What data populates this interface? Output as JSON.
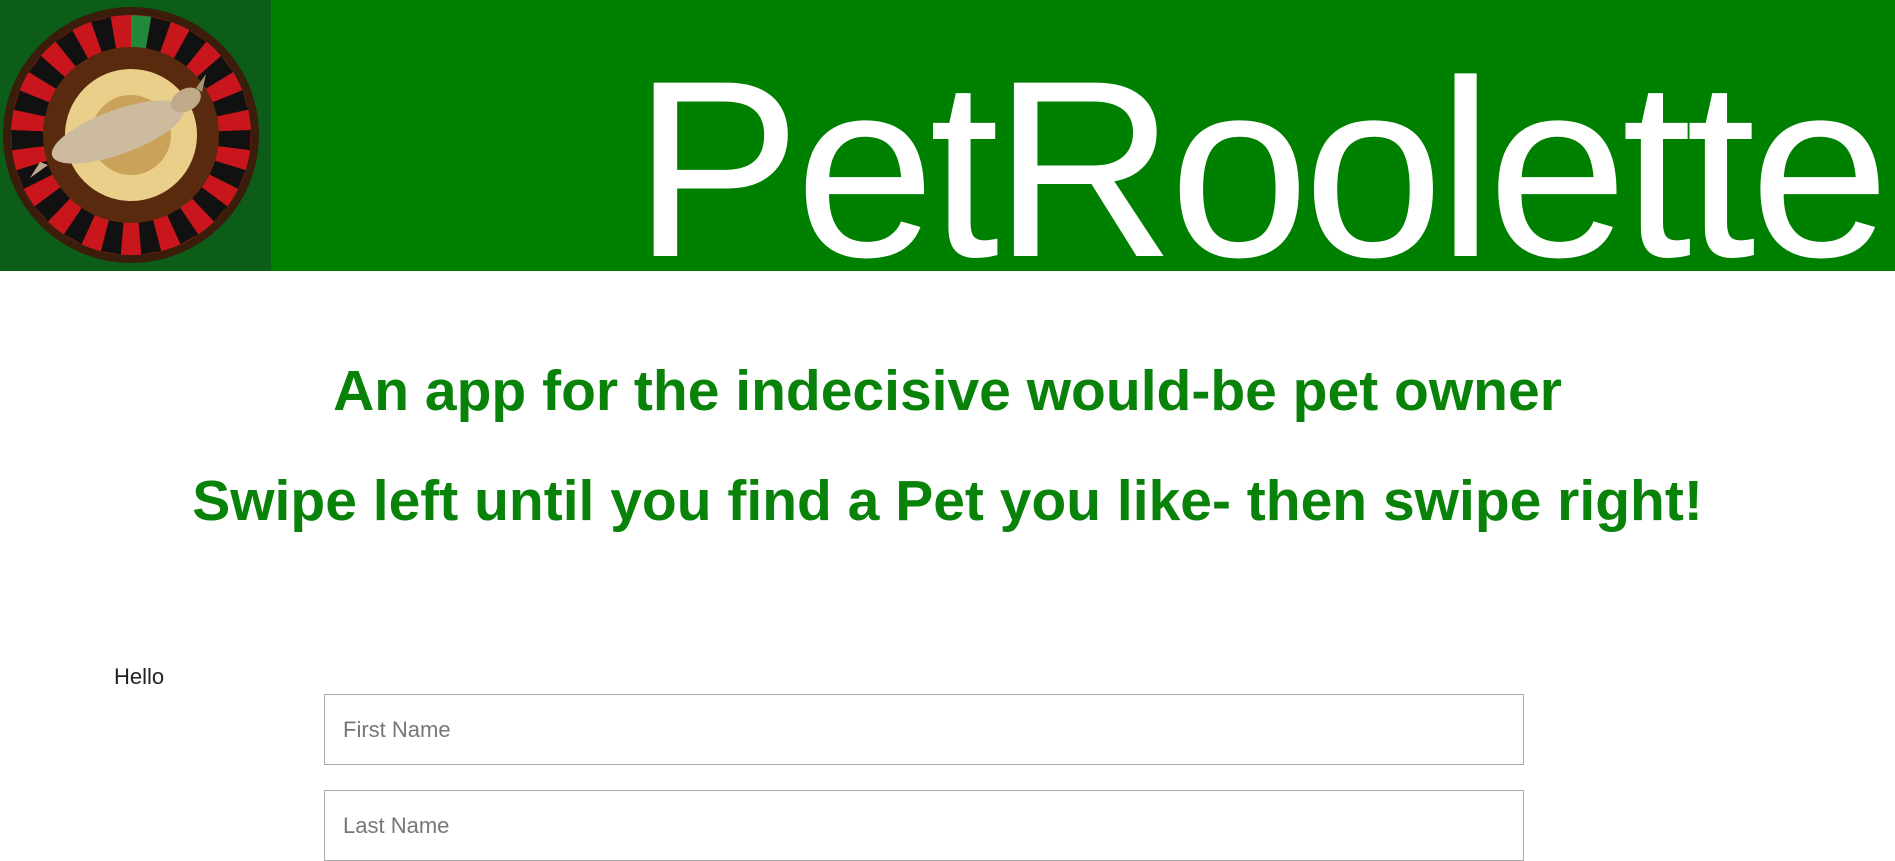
{
  "colors": {
    "header_bg": "#008000",
    "accent_text": "#088208"
  },
  "header": {
    "logo_icon": "roulette-wheel-kangaroo-logo",
    "brand": "PetRoolette"
  },
  "hero": {
    "tagline": "An app for the indecisive would-be pet owner",
    "instruction": "Swipe left until you find a Pet you like- then swipe right!"
  },
  "form": {
    "greeting": "Hello",
    "first_name": {
      "placeholder": "First Name",
      "value": ""
    },
    "last_name": {
      "placeholder": "Last Name",
      "value": ""
    }
  }
}
